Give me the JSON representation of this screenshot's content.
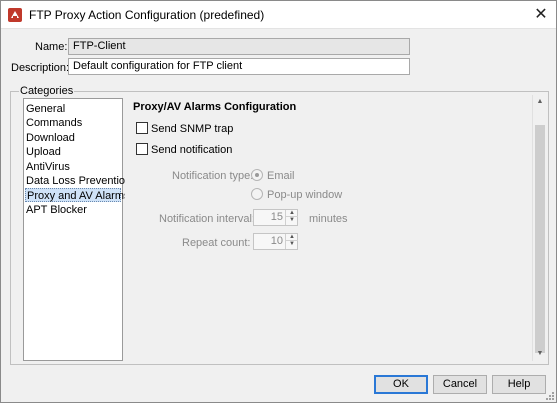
{
  "window": {
    "title": "FTP Proxy Action Configuration (predefined)",
    "close_glyph": "✕"
  },
  "form": {
    "name_label": "Name:",
    "name_value": "FTP-Client",
    "description_label": "Description:",
    "description_value": "Default configuration for FTP client"
  },
  "categories": {
    "group_label": "Categories",
    "items": [
      {
        "label": "General",
        "selected": false
      },
      {
        "label": "Commands",
        "selected": false
      },
      {
        "label": "Download",
        "selected": false
      },
      {
        "label": "Upload",
        "selected": false
      },
      {
        "label": "AntiVirus",
        "selected": false
      },
      {
        "label": "Data Loss Prevention",
        "selected": false
      },
      {
        "label": "Proxy and AV Alarms",
        "selected": true
      },
      {
        "label": "APT Blocker",
        "selected": false
      }
    ]
  },
  "panel": {
    "title": "Proxy/AV Alarms Configuration",
    "send_snmp_trap": {
      "label": "Send SNMP trap",
      "checked": false
    },
    "send_notification": {
      "label": "Send notification",
      "checked": false
    },
    "notification_type_label": "Notification type:",
    "notification_type_options": [
      {
        "label": "Email",
        "selected": true
      },
      {
        "label": "Pop-up window",
        "selected": false
      }
    ],
    "notification_interval_label": "Notification interval:",
    "notification_interval_value": "15",
    "notification_interval_unit": "minutes",
    "repeat_count_label": "Repeat count:",
    "repeat_count_value": "10",
    "spinner_up": "▲",
    "spinner_down": "▼"
  },
  "scrollbar": {
    "up_glyph": "▲",
    "down_glyph": "▼"
  },
  "buttons": {
    "ok": "OK",
    "cancel": "Cancel",
    "help": "Help"
  },
  "colors": {
    "selection": "#cfe2f7",
    "default_button_border": "#2a78d6",
    "app_icon": "#c0392b"
  }
}
